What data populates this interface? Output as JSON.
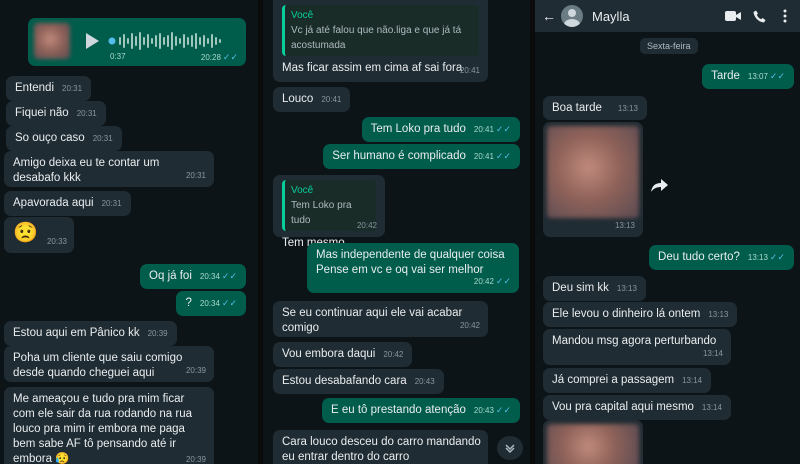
{
  "panel1": {
    "voice": {
      "elapsed": "0:37",
      "time": "20:28"
    },
    "messages": [
      {
        "text": "Entendi",
        "time": "20:31",
        "dir": "in"
      },
      {
        "text": "Fiquei não",
        "time": "20:31",
        "dir": "in"
      },
      {
        "text": "So ouço caso",
        "time": "20:31",
        "dir": "in"
      },
      {
        "text": "Amigo deixa eu te contar um desabafo kkk",
        "time": "20:31",
        "dir": "in"
      },
      {
        "text": "Apavorada aqui",
        "time": "20:31",
        "dir": "in"
      },
      {
        "text": "😟",
        "time": "20:33",
        "dir": "in"
      },
      {
        "text": "Oq já foi",
        "time": "20:34",
        "dir": "out"
      },
      {
        "text": "?",
        "time": "20:34",
        "dir": "out"
      },
      {
        "text": "Estou aqui em Pânico kk",
        "time": "20:39",
        "dir": "in"
      },
      {
        "text": "Poha um cliente que saiu comigo desde quando cheguei aqui",
        "time": "20:39",
        "dir": "in"
      },
      {
        "text": "Me ameaçou e tudo pra mim ficar com ele sair da rua rodando na rua louco pra mim ir embora me paga bem sabe AF tô pensando até ir embora 😥",
        "time": "20:39",
        "dir": "in"
      }
    ]
  },
  "panel2": {
    "messages": [
      {
        "quote_author": "Você",
        "quote_text": "Vc já até falou que não.liga e que já tá acostumada",
        "text": "Mas ficar assim em cima af sai fora",
        "time": "20:41",
        "dir": "in"
      },
      {
        "text": "Louco",
        "time": "20:41",
        "dir": "in"
      },
      {
        "text": "Tem Loko pra tudo",
        "time": "20:41",
        "dir": "out"
      },
      {
        "text": "Ser humano é complicado",
        "time": "20:41",
        "dir": "out"
      },
      {
        "quote_author": "Você",
        "quote_text": "Tem Loko pra tudo",
        "text": "Tem mesmo",
        "time": "20:42",
        "dir": "in"
      },
      {
        "text": "Mas independente de qualquer coisa Pense em vc e oq vai ser melhor",
        "time": "20:42",
        "dir": "out"
      },
      {
        "text": "Se eu continuar aqui ele vai acabar comigo",
        "time": "20:42",
        "dir": "in"
      },
      {
        "text": "Vou embora daqui",
        "time": "20:42",
        "dir": "in"
      },
      {
        "text": "Estou desabafando cara",
        "time": "20:43",
        "dir": "in"
      },
      {
        "text": "E eu tô prestando atenção",
        "time": "20:43",
        "dir": "out"
      },
      {
        "text": "Cara louco desceu do carro mandando eu entrar dentro do carro",
        "time": "",
        "dir": "in"
      }
    ]
  },
  "panel3": {
    "header": {
      "name": "Maylla"
    },
    "date_chip": "Sexta-feira",
    "messages": [
      {
        "text": "Tarde",
        "time": "13:07",
        "dir": "out"
      },
      {
        "text": "Boa tarde",
        "time": "13:13",
        "dir": "in"
      },
      {
        "text": "",
        "time": "13:13",
        "dir": "in",
        "kind": "image"
      },
      {
        "text": "Deu tudo certo?",
        "time": "13:13",
        "dir": "out"
      },
      {
        "text": "Deu sim kk",
        "time": "13:13",
        "dir": "in"
      },
      {
        "text": "Ele levou o dinheiro lá ontem",
        "time": "13:13",
        "dir": "in"
      },
      {
        "text": "Mandou msg agora perturbando",
        "time": "13:14",
        "dir": "in"
      },
      {
        "text": "Já comprei a passagem",
        "time": "13:14",
        "dir": "in"
      },
      {
        "text": "Vou pra capital aqui mesmo",
        "time": "13:14",
        "dir": "in"
      }
    ]
  },
  "colors": {
    "incoming": "#202c33",
    "outgoing": "#005c4b",
    "background": "#0d1418",
    "read_tick": "#53bdeb"
  },
  "icons": [
    "back-arrow-icon",
    "video-call-icon",
    "phone-icon",
    "more-menu-icon",
    "play-icon",
    "forward-icon",
    "scroll-down-icon",
    "double-check-icon"
  ]
}
